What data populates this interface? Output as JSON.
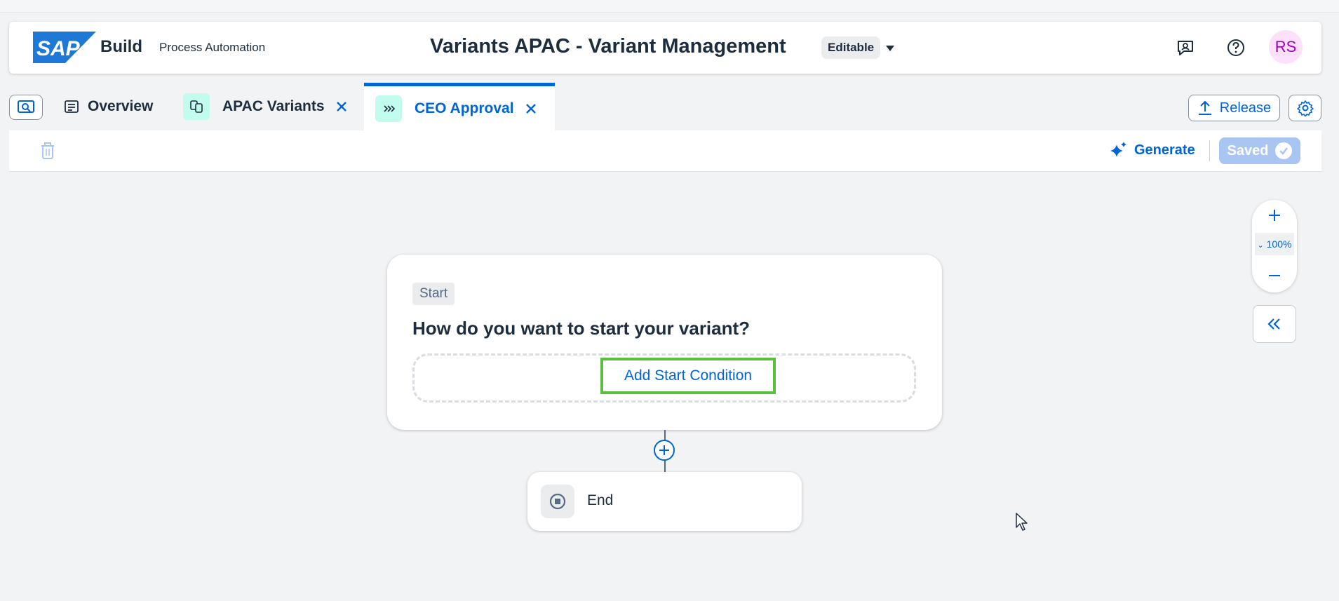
{
  "shell": {
    "brand": "Build",
    "product": "Process Automation",
    "document_title": "Variants APAC - Variant Management",
    "status_badge": "Editable",
    "avatar_initials": "RS",
    "icons": [
      "feedback-icon",
      "help-icon"
    ]
  },
  "tabs": [
    {
      "label": "Overview",
      "icon": "list-icon",
      "closable": false,
      "active": false
    },
    {
      "label": "APAC Variants",
      "icon": "variants-icon",
      "closable": true,
      "active": false
    },
    {
      "label": "CEO Approval",
      "icon": "chevrons-icon",
      "closable": true,
      "active": true
    }
  ],
  "tab_actions": {
    "release_label": "Release"
  },
  "toolbar": {
    "generate_label": "Generate",
    "saved_label": "Saved"
  },
  "start_card": {
    "badge": "Start",
    "question": "How do you want to start your variant?",
    "add_condition_label": "Add Start Condition"
  },
  "end_node": {
    "label": "End"
  },
  "zoom": {
    "level": "100%"
  },
  "colors": {
    "accent": "#0064d9",
    "highlight_border": "#5abf3f",
    "avatar_bg": "#fde0f9",
    "avatar_text": "#a100c2"
  }
}
